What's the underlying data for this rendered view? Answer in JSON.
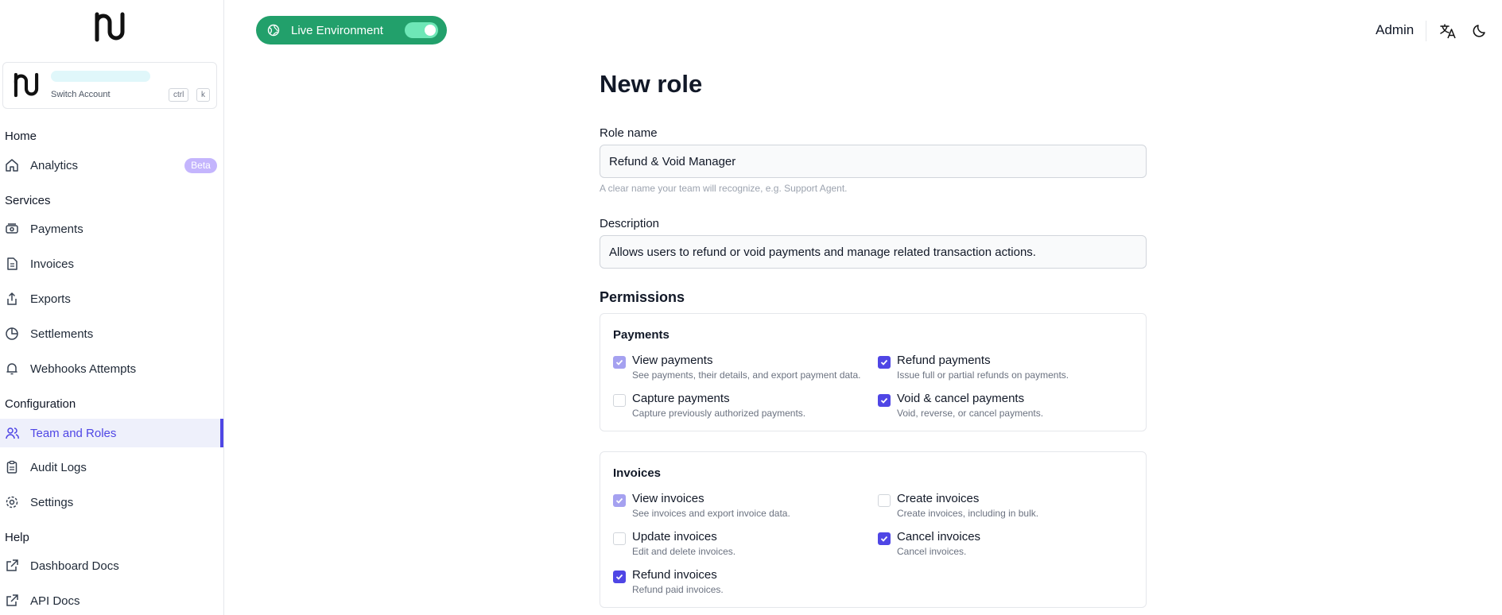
{
  "sidebar": {
    "switch_account": "Switch Account",
    "kbd_ctrl": "ctrl",
    "kbd_k": "k",
    "sections": {
      "home": "Home",
      "services": "Services",
      "configuration": "Configuration",
      "help": "Help"
    },
    "items": {
      "analytics": "Analytics",
      "analytics_badge": "Beta",
      "payments": "Payments",
      "invoices": "Invoices",
      "exports": "Exports",
      "settlements": "Settlements",
      "webhooks": "Webhooks Attempts",
      "team_roles": "Team and Roles",
      "audit_logs": "Audit Logs",
      "settings": "Settings",
      "dashboard_docs": "Dashboard Docs",
      "api_docs": "API Docs"
    },
    "active_item": "team_roles"
  },
  "topbar": {
    "environment_label": "Live Environment",
    "environment_on": true,
    "user": "Admin"
  },
  "form": {
    "title": "New role",
    "role_name_label": "Role name",
    "role_name_value": "Refund & Void Manager",
    "role_name_help": "A clear name your team will recognize, e.g. Support Agent.",
    "description_label": "Description",
    "description_value": "Allows users to refund or void payments and manage related transaction actions.",
    "permissions_title": "Permissions"
  },
  "permission_groups": {
    "payments": {
      "title": "Payments",
      "items": [
        {
          "title": "View payments",
          "desc": "See payments, their details, and export payment data.",
          "state": "checked-locked"
        },
        {
          "title": "Refund payments",
          "desc": "Issue full or partial refunds on payments.",
          "state": "checked"
        },
        {
          "title": "Capture payments",
          "desc": "Capture previously authorized payments.",
          "state": "unchecked"
        },
        {
          "title": "Void & cancel payments",
          "desc": "Void, reverse, or cancel payments.",
          "state": "checked"
        }
      ]
    },
    "invoices": {
      "title": "Invoices",
      "items": [
        {
          "title": "View invoices",
          "desc": "See invoices and export invoice data.",
          "state": "checked-locked"
        },
        {
          "title": "Create invoices",
          "desc": "Create invoices, including in bulk.",
          "state": "unchecked"
        },
        {
          "title": "Update invoices",
          "desc": "Edit and delete invoices.",
          "state": "unchecked"
        },
        {
          "title": "Cancel invoices",
          "desc": "Cancel invoices.",
          "state": "checked"
        },
        {
          "title": "Refund invoices",
          "desc": "Refund paid invoices.",
          "state": "checked"
        }
      ]
    }
  },
  "colors": {
    "accent": "#4f46e5",
    "live_green": "#22a06b",
    "beta_badge": "#c4b5fd"
  }
}
